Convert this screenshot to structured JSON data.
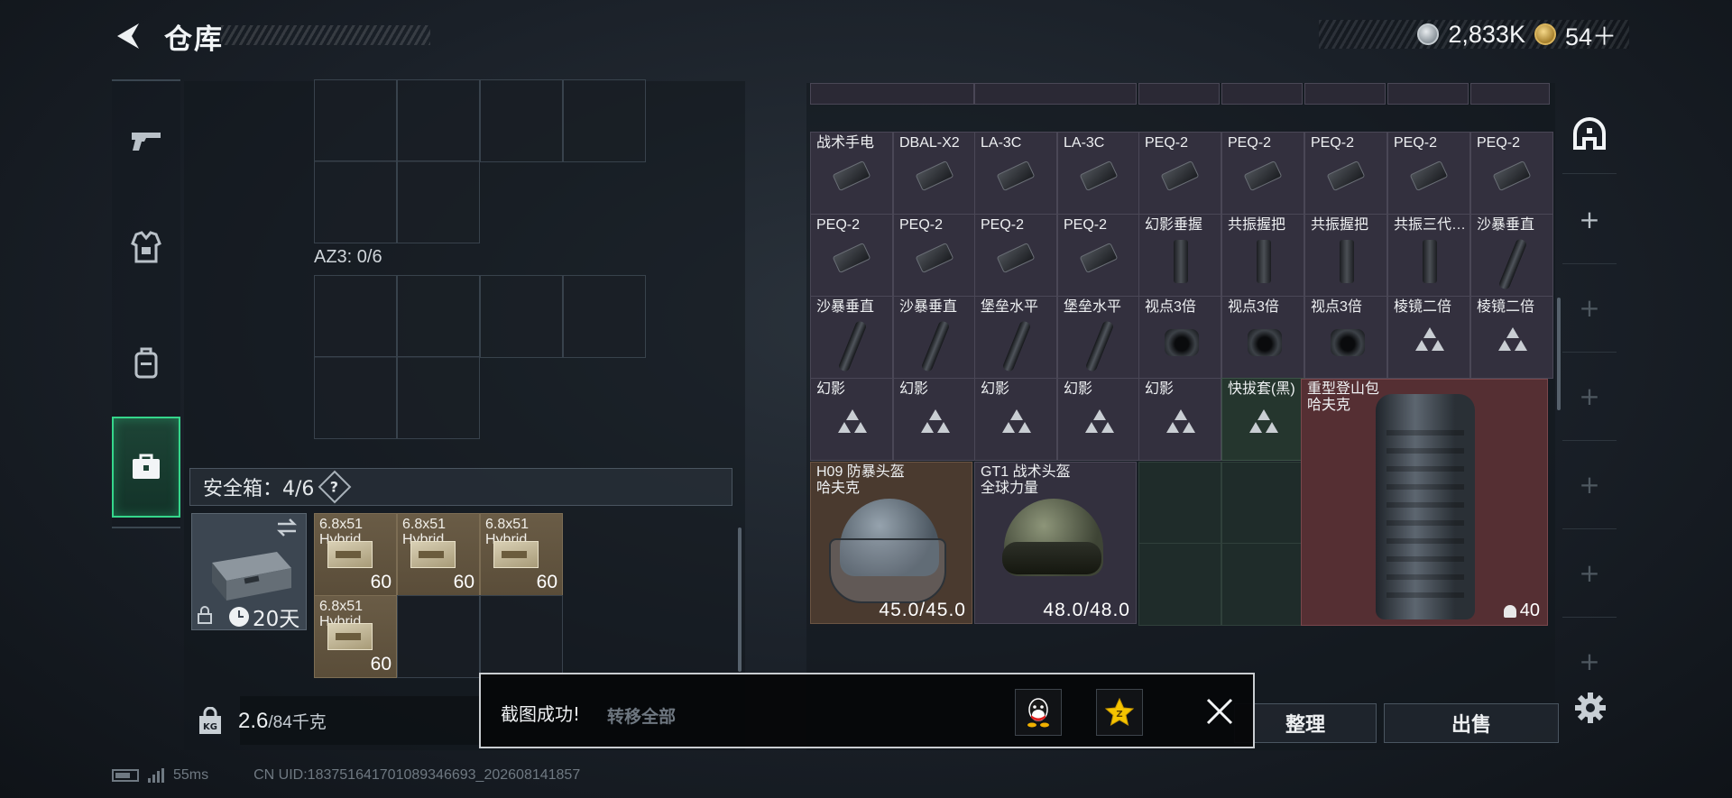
{
  "header": {
    "title": "仓库",
    "currencies": [
      {
        "icon": "silver-coin-icon",
        "value": "2,833K"
      },
      {
        "icon": "gold-coin-icon",
        "value": "54＋"
      }
    ]
  },
  "sidebar": {
    "items": [
      {
        "icon": "pistol-icon",
        "active": false
      },
      {
        "icon": "armor-vest-icon",
        "active": false
      },
      {
        "icon": "backpack-icon",
        "active": false
      },
      {
        "icon": "briefcase-icon",
        "active": true
      }
    ]
  },
  "left": {
    "az3_label": "AZ3: 0/6",
    "safe_box_label": "安全箱：4/6",
    "safe_help": "?",
    "safe_timer": "20天",
    "ammo": [
      {
        "name": "6.8x51",
        "sub": "Hybrid",
        "qty": "60"
      },
      {
        "name": "6.8x51",
        "sub": "Hybrid",
        "qty": "60"
      },
      {
        "name": "6.8x51",
        "sub": "Hybrid",
        "qty": "60"
      },
      {
        "name": "6.8x51",
        "sub": "Hybrid",
        "qty": "60"
      }
    ],
    "weight_value": "2.6",
    "weight_max": "/84千克"
  },
  "stash": {
    "row1": [
      "战术手电",
      "DBAL-X2",
      "LA-3C",
      "LA-3C",
      "PEQ-2",
      "PEQ-2",
      "PEQ-2",
      "PEQ-2",
      "PEQ-2"
    ],
    "row2": [
      "PEQ-2",
      "PEQ-2",
      "PEQ-2",
      "PEQ-2",
      "幻影垂握",
      "共振握把",
      "共振握把",
      "共振三代…",
      "沙暴垂直"
    ],
    "row3": [
      "沙暴垂直",
      "沙暴垂直",
      "堡垒水平",
      "堡垒水平",
      "视点3倍",
      "视点3倍",
      "视点3倍",
      "棱镜二倍",
      "棱镜二倍"
    ],
    "row4": [
      "幻影",
      "幻影",
      "幻影",
      "幻影",
      "幻影",
      "快拔套(黑)"
    ],
    "backpack": {
      "name": "重型登山包",
      "brand": "哈夫克",
      "capacity": "40"
    },
    "helmets": [
      {
        "name": "H09 防暴头盔",
        "brand": "哈夫克",
        "durability": "45.0/45.0"
      },
      {
        "name": "GT1 战术头盔",
        "brand": "全球力量",
        "durability": "48.0/48.0"
      }
    ]
  },
  "actions": {
    "sort": "整理",
    "sell": "出售"
  },
  "toast": {
    "message": "截图成功!",
    "behind_text": "转移全部"
  },
  "status": {
    "ping": "55ms",
    "uid": "CN UID:18375164170108934669​3_202608141857"
  }
}
